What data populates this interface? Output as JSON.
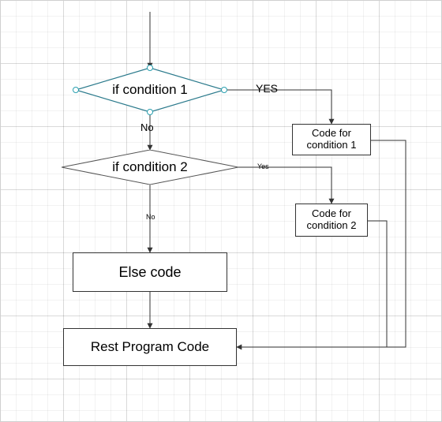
{
  "diagram": {
    "type": "flowchart",
    "decision1": {
      "label": "if condition 1",
      "yes": "YES",
      "no": "No"
    },
    "decision2": {
      "label": "if condition 2",
      "yes": "Yes",
      "no": "No"
    },
    "code1": "Code for\ncondition 1",
    "code2": "Code for\ncondition 2",
    "elseCode": "Else code",
    "rest": "Rest Program Code"
  }
}
